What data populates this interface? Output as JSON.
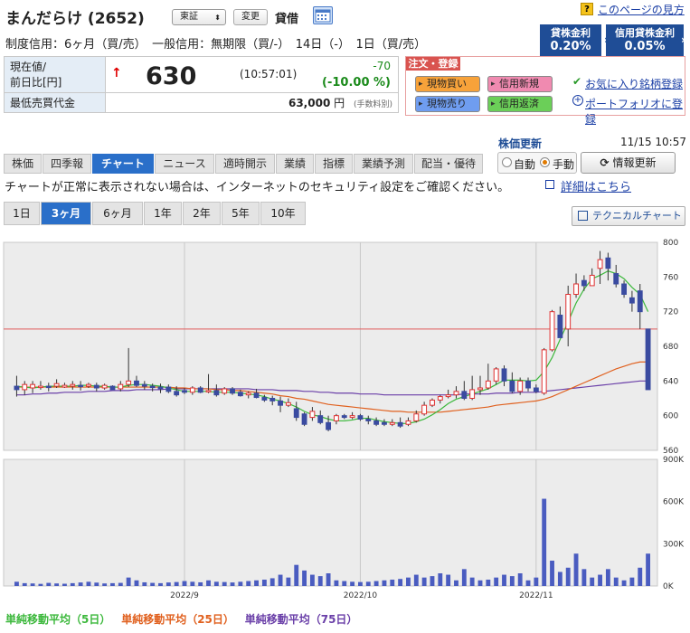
{
  "header": {
    "title": "まんだらけ (2652)",
    "market_select": "東証",
    "change_button": "変更",
    "lending_label": "貸借",
    "help_link": "このページの見方",
    "conditions": "制度信用：6ヶ月（買/売）　一般信用：無期限（買/-）　14日（-）　1日（買/売）",
    "rates": [
      {
        "label": "貸株金利",
        "value": "0.20%"
      },
      {
        "label": "信用貸株金利",
        "value": "0.05%"
      }
    ]
  },
  "price": {
    "current_label": "現在値/",
    "change_label": "前日比[円]",
    "arrow": "↑",
    "value": "630",
    "time": "(10:57:01)",
    "change": "-70",
    "change_pct": "(-10.00 %)",
    "min_label": "最低売買代金",
    "min_value": "63,000",
    "min_unit": "円",
    "min_note": "(手数料別)"
  },
  "order": {
    "header": "注文・登録",
    "buttons": [
      "現物買い",
      "信用新規",
      "現物売り",
      "信用返済"
    ],
    "links": [
      "お気に入り銘柄登録",
      "ポートフォリオに登録"
    ],
    "colors": {
      "buy": "#f7a23a",
      "margin_new": "#f08ab0",
      "sell": "#6f9df0",
      "margin_close": "#6bcf58"
    }
  },
  "refresh": {
    "label": "株価更新",
    "timestamp": "11/15 10:57",
    "auto": "自動",
    "manual": "手動",
    "update_button": "情報更新"
  },
  "tabs": [
    "株価",
    "四季報",
    "チャート",
    "ニュース",
    "適時開示",
    "業績",
    "指標",
    "業績予測",
    "配当・優待"
  ],
  "notice": "チャートが正常に表示されない場合は、インターネットのセキュリティ設定をご確認ください。",
  "notice_link": "詳細はこちら",
  "periods": [
    "1日",
    "3ヶ月",
    "6ヶ月",
    "1年",
    "2年",
    "5年",
    "10年"
  ],
  "tech_chart_button": "テクニカルチャート",
  "legend": [
    {
      "label": "単純移動平均（5日）",
      "color": "#3cb83c"
    },
    {
      "label": "単純移動平均（25日）",
      "color": "#e0601e"
    },
    {
      "label": "単純移動平均（75日）",
      "color": "#6a3fa8"
    }
  ],
  "chart_data": {
    "type": "candlestick",
    "price_ylim": [
      560,
      800
    ],
    "price_ticks": [
      560,
      600,
      640,
      680,
      720,
      760,
      800
    ],
    "volume_ylim": [
      0,
      900000
    ],
    "volume_ticks": [
      "0K",
      "300K",
      "600K",
      "900K"
    ],
    "x_labels": [
      "2022/9",
      "2022/10",
      "2022/11"
    ],
    "prev_close_line": 700,
    "candles": [
      [
        634,
        630,
        622,
        646
      ],
      [
        630,
        636,
        624,
        640
      ],
      [
        632,
        636,
        626,
        640
      ],
      [
        633,
        634,
        630,
        640
      ],
      [
        634,
        633,
        628,
        638
      ],
      [
        634,
        637,
        632,
        642
      ],
      [
        633,
        635,
        632,
        638
      ],
      [
        634,
        636,
        630,
        640
      ],
      [
        635,
        634,
        629,
        640
      ],
      [
        634,
        636,
        632,
        638
      ],
      [
        635,
        632,
        628,
        638
      ],
      [
        632,
        635,
        630,
        637
      ],
      [
        634,
        630,
        630,
        635
      ],
      [
        631,
        636,
        628,
        640
      ],
      [
        636,
        640,
        633,
        678
      ],
      [
        640,
        635,
        633,
        646
      ],
      [
        636,
        634,
        630,
        640
      ],
      [
        634,
        633,
        628,
        637
      ],
      [
        633,
        631,
        626,
        637
      ],
      [
        633,
        628,
        626,
        636
      ],
      [
        628,
        624,
        622,
        634
      ],
      [
        629,
        627,
        625,
        632
      ],
      [
        627,
        632,
        624,
        634
      ],
      [
        632,
        627,
        626,
        634
      ],
      [
        628,
        629,
        626,
        648
      ],
      [
        629,
        624,
        622,
        636
      ],
      [
        626,
        631,
        624,
        633
      ],
      [
        631,
        626,
        624,
        633
      ],
      [
        627,
        623,
        622,
        630
      ],
      [
        624,
        626,
        620,
        628
      ],
      [
        626,
        621,
        620,
        631
      ],
      [
        621,
        618,
        616,
        624
      ],
      [
        620,
        617,
        612,
        623
      ],
      [
        617,
        612,
        604,
        622
      ],
      [
        612,
        615,
        610,
        620
      ],
      [
        608,
        598,
        594,
        616
      ],
      [
        602,
        590,
        588,
        604
      ],
      [
        598,
        605,
        594,
        610
      ],
      [
        600,
        592,
        590,
        606
      ],
      [
        592,
        584,
        582,
        600
      ],
      [
        594,
        600,
        590,
        602
      ],
      [
        600,
        598,
        596,
        602
      ],
      [
        598,
        600,
        596,
        604
      ],
      [
        600,
        596,
        594,
        602
      ],
      [
        596,
        594,
        590,
        600
      ],
      [
        594,
        590,
        588,
        598
      ],
      [
        592,
        590,
        588,
        596
      ],
      [
        590,
        592,
        588,
        596
      ],
      [
        592,
        588,
        586,
        598
      ],
      [
        590,
        594,
        588,
        598
      ],
      [
        594,
        602,
        592,
        606
      ],
      [
        602,
        612,
        600,
        616
      ],
      [
        612,
        618,
        610,
        620
      ],
      [
        618,
        622,
        614,
        624
      ],
      [
        622,
        624,
        620,
        630
      ],
      [
        624,
        628,
        620,
        634
      ],
      [
        628,
        620,
        618,
        640
      ],
      [
        620,
        630,
        618,
        646
      ],
      [
        630,
        632,
        624,
        646
      ],
      [
        632,
        640,
        630,
        660
      ],
      [
        640,
        654,
        636,
        656
      ],
      [
        654,
        640,
        634,
        658
      ],
      [
        640,
        628,
        626,
        650
      ],
      [
        628,
        640,
        624,
        644
      ],
      [
        640,
        632,
        628,
        644
      ],
      [
        632,
        628,
        626,
        636
      ],
      [
        626,
        676,
        624,
        678
      ],
      [
        676,
        720,
        674,
        722
      ],
      [
        716,
        690,
        690,
        726
      ],
      [
        700,
        740,
        680,
        750
      ],
      [
        740,
        752,
        736,
        764
      ],
      [
        756,
        750,
        744,
        762
      ],
      [
        750,
        762,
        750,
        770
      ],
      [
        770,
        780,
        752,
        790
      ],
      [
        782,
        770,
        756,
        788
      ],
      [
        764,
        752,
        748,
        774
      ],
      [
        752,
        740,
        736,
        756
      ],
      [
        736,
        730,
        720,
        744
      ],
      [
        744,
        720,
        700,
        752
      ],
      [
        700,
        630,
        630,
        682
      ]
    ],
    "ma5": [
      634,
      633,
      632,
      633,
      634,
      634,
      634,
      634,
      635,
      635,
      634,
      634,
      633,
      633,
      635,
      636,
      636,
      635,
      634,
      632,
      630,
      628,
      628,
      628,
      628,
      627,
      627,
      627,
      626,
      625,
      624,
      622,
      619,
      617,
      614,
      610,
      605,
      601,
      599,
      596,
      594,
      594,
      595,
      597,
      597,
      595,
      593,
      592,
      591,
      591,
      593,
      596,
      601,
      607,
      614,
      619,
      622,
      625,
      628,
      631,
      636,
      641,
      641,
      641,
      640,
      641,
      651,
      667,
      688,
      708,
      730,
      746,
      758,
      762,
      767,
      764,
      758,
      748,
      740,
      720
    ],
    "ma25": [
      633,
      633,
      633,
      633,
      633,
      633,
      633,
      633,
      633,
      633,
      633,
      633,
      633,
      633,
      633,
      633,
      633,
      633,
      633,
      633,
      632,
      632,
      631,
      631,
      631,
      630,
      630,
      629,
      629,
      628,
      627,
      626,
      625,
      623,
      622,
      620,
      619,
      617,
      615,
      613,
      612,
      611,
      610,
      609,
      608,
      607,
      606,
      605,
      605,
      604,
      604,
      604,
      604,
      604,
      605,
      606,
      607,
      608,
      609,
      610,
      612,
      613,
      614,
      615,
      616,
      617,
      619,
      622,
      626,
      630,
      634,
      638,
      642,
      646,
      650,
      654,
      657,
      660,
      662,
      662
    ],
    "ma75": [
      624,
      624,
      625,
      625,
      626,
      626,
      627,
      627,
      627,
      628,
      628,
      628,
      629,
      629,
      629,
      630,
      630,
      630,
      630,
      631,
      631,
      631,
      631,
      631,
      631,
      631,
      631,
      631,
      631,
      631,
      630,
      630,
      630,
      629,
      629,
      629,
      628,
      628,
      627,
      627,
      626,
      626,
      626,
      625,
      625,
      625,
      624,
      624,
      624,
      624,
      624,
      624,
      624,
      624,
      624,
      624,
      625,
      625,
      625,
      625,
      626,
      626,
      626,
      627,
      627,
      627,
      628,
      629,
      630,
      631,
      632,
      633,
      634,
      635,
      636,
      637,
      638,
      639,
      640,
      640
    ],
    "volume": [
      30000,
      20000,
      18000,
      15000,
      22000,
      18000,
      16000,
      20000,
      25000,
      30000,
      24000,
      18000,
      20000,
      22000,
      60000,
      40000,
      26000,
      22000,
      20000,
      25000,
      28000,
      35000,
      30000,
      26000,
      40000,
      30000,
      28000,
      25000,
      30000,
      35000,
      40000,
      45000,
      55000,
      80000,
      60000,
      150000,
      110000,
      80000,
      70000,
      90000,
      40000,
      35000,
      30000,
      28000,
      30000,
      35000,
      40000,
      45000,
      50000,
      60000,
      80000,
      60000,
      70000,
      90000,
      80000,
      40000,
      120000,
      60000,
      40000,
      45000,
      60000,
      80000,
      70000,
      90000,
      40000,
      60000,
      620000,
      180000,
      100000,
      130000,
      230000,
      120000,
      60000,
      80000,
      120000,
      60000,
      40000,
      60000,
      130000,
      230000
    ]
  }
}
